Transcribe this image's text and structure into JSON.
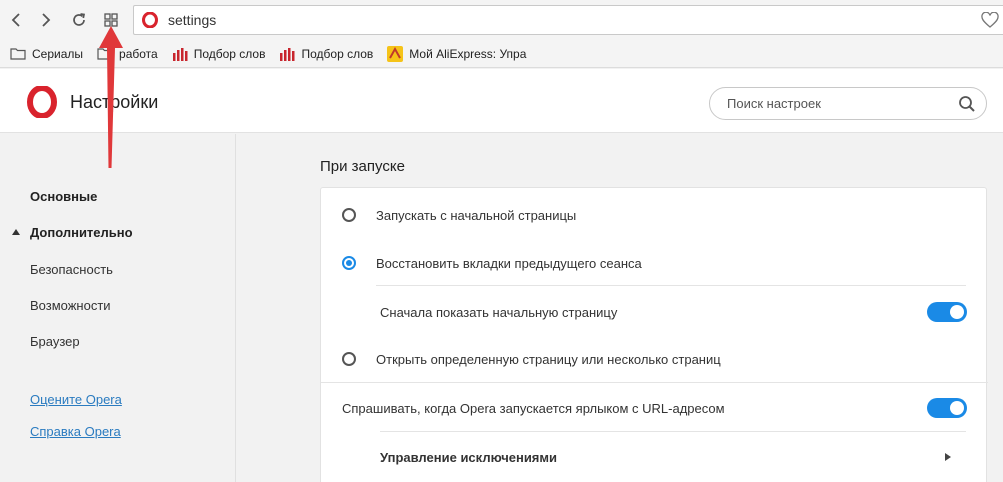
{
  "browser": {
    "url": "settings",
    "bookmarks": [
      {
        "label": "Сериалы",
        "icon": "folder-icon"
      },
      {
        "label": "работа",
        "icon": "folder-icon"
      },
      {
        "label": "Подбор слов",
        "icon": "bar-chart-icon"
      },
      {
        "label": "Подбор слов",
        "icon": "bar-chart-icon"
      },
      {
        "label": "Мой AliExpress: Упра",
        "icon": "aliexpress-icon"
      }
    ]
  },
  "header": {
    "title": "Настройки",
    "search_placeholder": "Поиск настроек"
  },
  "sidebar": {
    "items": [
      {
        "label": "Основные"
      },
      {
        "label": "Дополнительно"
      },
      {
        "label": "Безопасность"
      },
      {
        "label": "Возможности"
      },
      {
        "label": "Браузер"
      }
    ],
    "links": [
      {
        "label": "Оцените Opera"
      },
      {
        "label": "Справка Opera"
      }
    ]
  },
  "startup": {
    "title": "При запуске",
    "options": [
      {
        "label": "Запускать с начальной страницы",
        "selected": false
      },
      {
        "label": "Восстановить вкладки предыдущего сеанса",
        "selected": true
      },
      {
        "label": "Открыть определенную страницу или несколько страниц",
        "selected": false
      }
    ],
    "show_start_page": {
      "label": "Сначала показать начальную страницу",
      "on": true
    },
    "ask_url_shortcut": {
      "label": "Спрашивать, когда Opera запускается ярлыком с URL-адресом",
      "on": true
    },
    "manage_exceptions": {
      "label": "Управление исключениями"
    }
  },
  "colors": {
    "accent": "#1a8ae6",
    "opera_red": "#d9232d",
    "link": "#2a7bc0",
    "annotation_arrow": "#e0383a"
  }
}
